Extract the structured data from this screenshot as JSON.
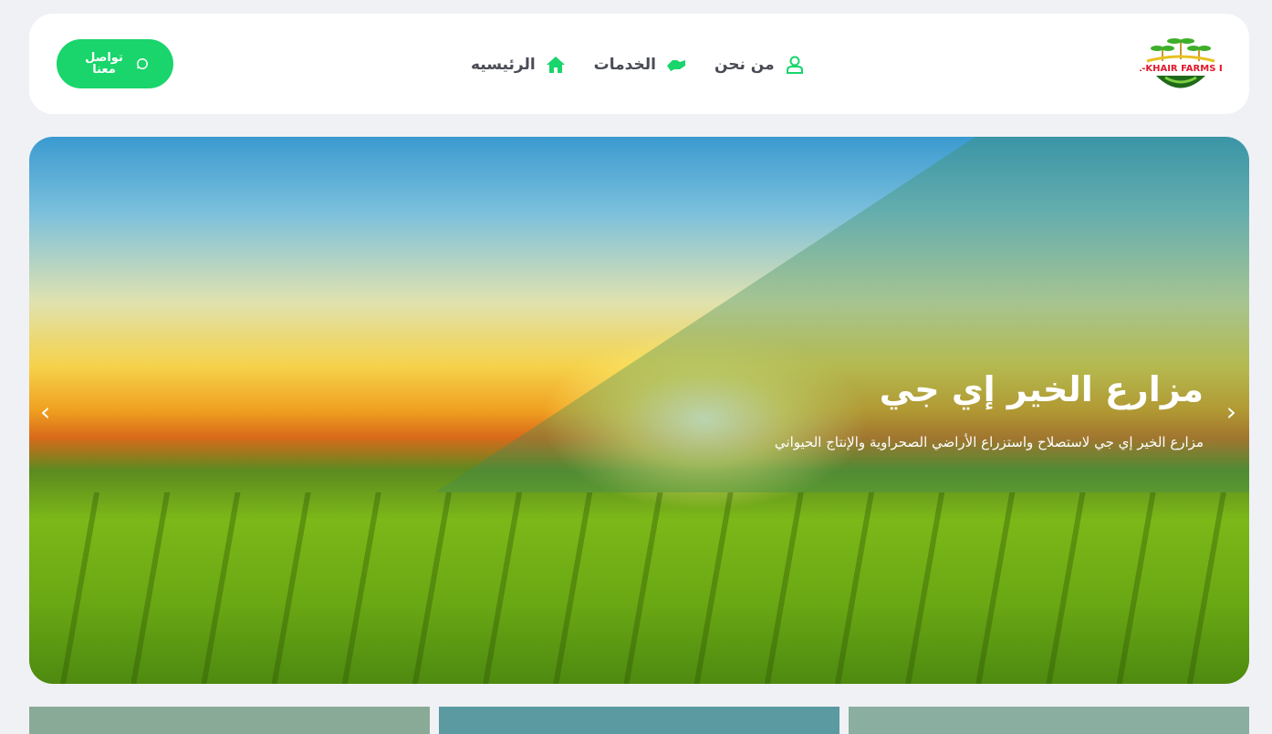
{
  "header": {
    "logo_text": "AL-KHAIR FARMS EG",
    "nav": [
      {
        "label": "الرئيسيه",
        "icon": "home-icon"
      },
      {
        "label": "الخدمات",
        "icon": "handshake-icon"
      },
      {
        "label": "من نحن",
        "icon": "user-icon"
      }
    ],
    "cta_label": "تواصل معنا",
    "cta_icon": "whatsapp-icon"
  },
  "hero": {
    "title": "مزارع الخير إي جي",
    "subtitle": "مزارع الخير إي جي لاستصلاح واستزراع الأراضي الصحراوية والإنتاج الحيواني"
  },
  "colors": {
    "accent": "#19d56b",
    "text": "#4a4c55"
  }
}
